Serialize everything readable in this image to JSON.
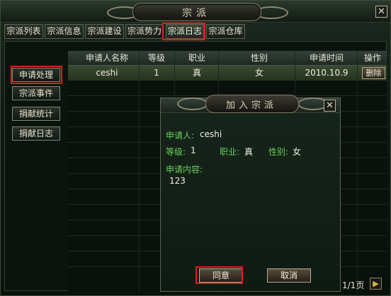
{
  "window": {
    "title": "宗派",
    "close_glyph": "✕"
  },
  "tabs": [
    {
      "label": "宗派列表"
    },
    {
      "label": "宗派信息"
    },
    {
      "label": "宗派建设"
    },
    {
      "label": "宗派势力"
    },
    {
      "label": "宗派日志",
      "active": true
    },
    {
      "label": "宗派仓库"
    }
  ],
  "sidebar": {
    "items": [
      {
        "label": "申请处理",
        "highlighted": true
      },
      {
        "label": "宗派事件"
      },
      {
        "label": "捐献统计"
      },
      {
        "label": "捐献日志"
      }
    ]
  },
  "table": {
    "headers": [
      "申请人名称",
      "等级",
      "职业",
      "性别",
      "申请时间",
      "操作"
    ],
    "rows": [
      {
        "name": "ceshi",
        "level": "1",
        "class": "真",
        "gender": "女",
        "time": "2010.10.9",
        "action": "删除"
      }
    ]
  },
  "pagination": {
    "text": "1/1页",
    "next_glyph": "▶"
  },
  "dialog": {
    "title": "加入宗派",
    "close_glyph": "✕",
    "applicant_label": "申请人:",
    "applicant_value": "ceshi",
    "level_label": "等级:",
    "level_value": "1",
    "class_label": "职业:",
    "class_value": "真",
    "gender_label": "性别:",
    "gender_value": "女",
    "content_label": "申请内容:",
    "content_value": "123",
    "agree_label": "同意",
    "cancel_label": "取消"
  },
  "colors": {
    "accent_green": "#6ccf5a",
    "highlight_red": "#e21c1c"
  }
}
